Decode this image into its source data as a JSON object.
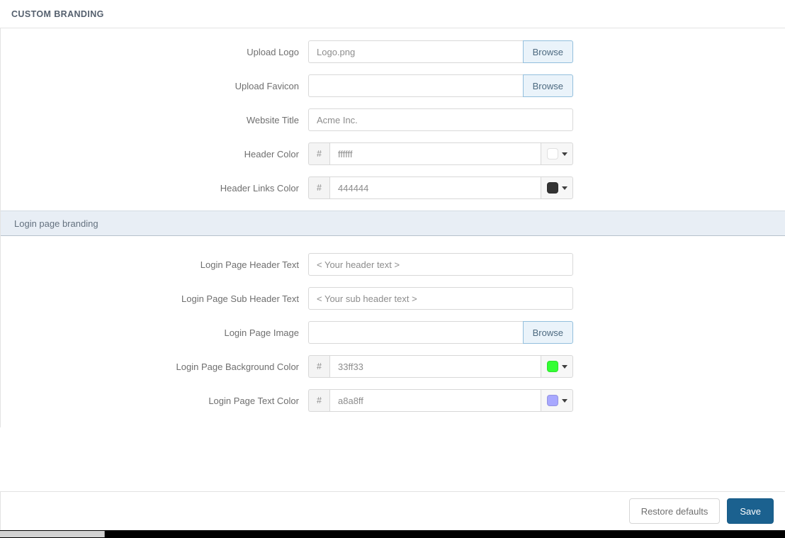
{
  "panel": {
    "title": "CUSTOM BRANDING"
  },
  "sections": [
    {
      "id": "custom-branding",
      "fields": [
        {
          "label": "Upload Logo",
          "type": "file",
          "value": "Logo.png",
          "placeholder": "",
          "button_label": "Browse"
        },
        {
          "label": "Upload Favicon",
          "type": "file",
          "value": "",
          "placeholder": "",
          "button_label": "Browse"
        },
        {
          "label": "Website Title",
          "type": "text",
          "value": "Acme Inc.",
          "placeholder": ""
        },
        {
          "label": "Header Color",
          "type": "color",
          "prefix": "#",
          "value": "ffffff",
          "swatch": "#ffffff"
        },
        {
          "label": "Header Links Color",
          "type": "color",
          "prefix": "#",
          "value": "444444",
          "swatch": "#333333"
        }
      ]
    }
  ],
  "band": {
    "label": "Login page branding"
  },
  "login_section": {
    "fields": [
      {
        "label": "Login Page Header Text",
        "type": "text",
        "value": "< Your header text >",
        "placeholder": "< Your header text >"
      },
      {
        "label": "Login Page Sub Header Text",
        "type": "text",
        "value": "< Your sub header text >",
        "placeholder": "< Your sub header text >"
      },
      {
        "label": "Login Page Image",
        "type": "file",
        "value": "",
        "placeholder": "",
        "button_label": "Browse"
      },
      {
        "label": "Login Page Background Color",
        "type": "color",
        "prefix": "#",
        "value": "33ff33",
        "swatch": "#33ff33"
      },
      {
        "label": "Login Page Text Color",
        "type": "color",
        "prefix": "#",
        "value": "a8a8ff",
        "swatch": "#a8a8ff"
      }
    ]
  },
  "footer": {
    "restore_label": "Restore defaults",
    "save_label": "Save"
  }
}
